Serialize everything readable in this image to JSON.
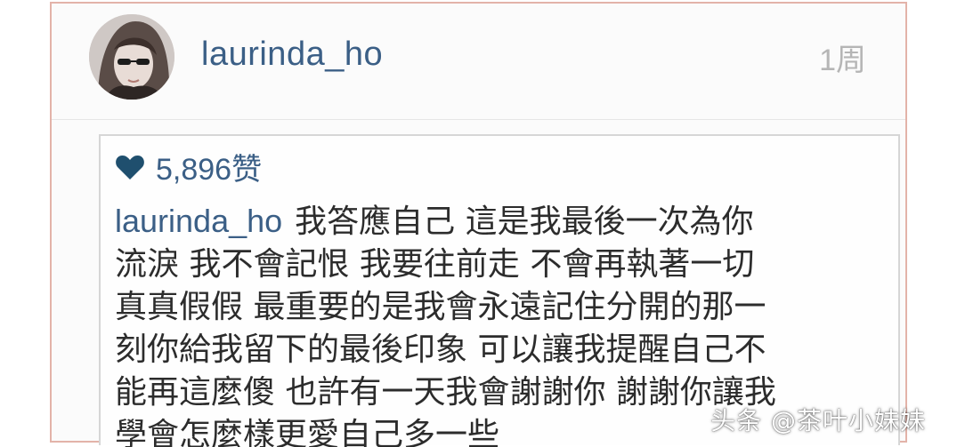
{
  "post": {
    "username": "laurinda_ho",
    "timestamp": "1周",
    "likes_count": "5,896赞",
    "caption_user": "laurinda_ho",
    "caption_lines": [
      "我答應自己 這是我最後一次為你",
      "流淚 我不會記恨 我要往前走 不會再執著一切",
      "真真假假 最重要的是我會永遠記住分開的那一",
      "刻你給我留下的最後印象 可以讓我提醒自己不",
      "能再這麼傻 也許有一天我會謝謝你 謝謝你讓我",
      "學會怎麼樣更愛自己多一些"
    ]
  },
  "watermark": "头条 @茶叶小妹妹",
  "icons": {
    "heart": "heart-icon",
    "avatar": "avatar"
  },
  "colors": {
    "username": "#3b5f86",
    "timestamp": "#b5b5b5",
    "text": "#2c2c2c",
    "frame": "#e3b3a9"
  }
}
